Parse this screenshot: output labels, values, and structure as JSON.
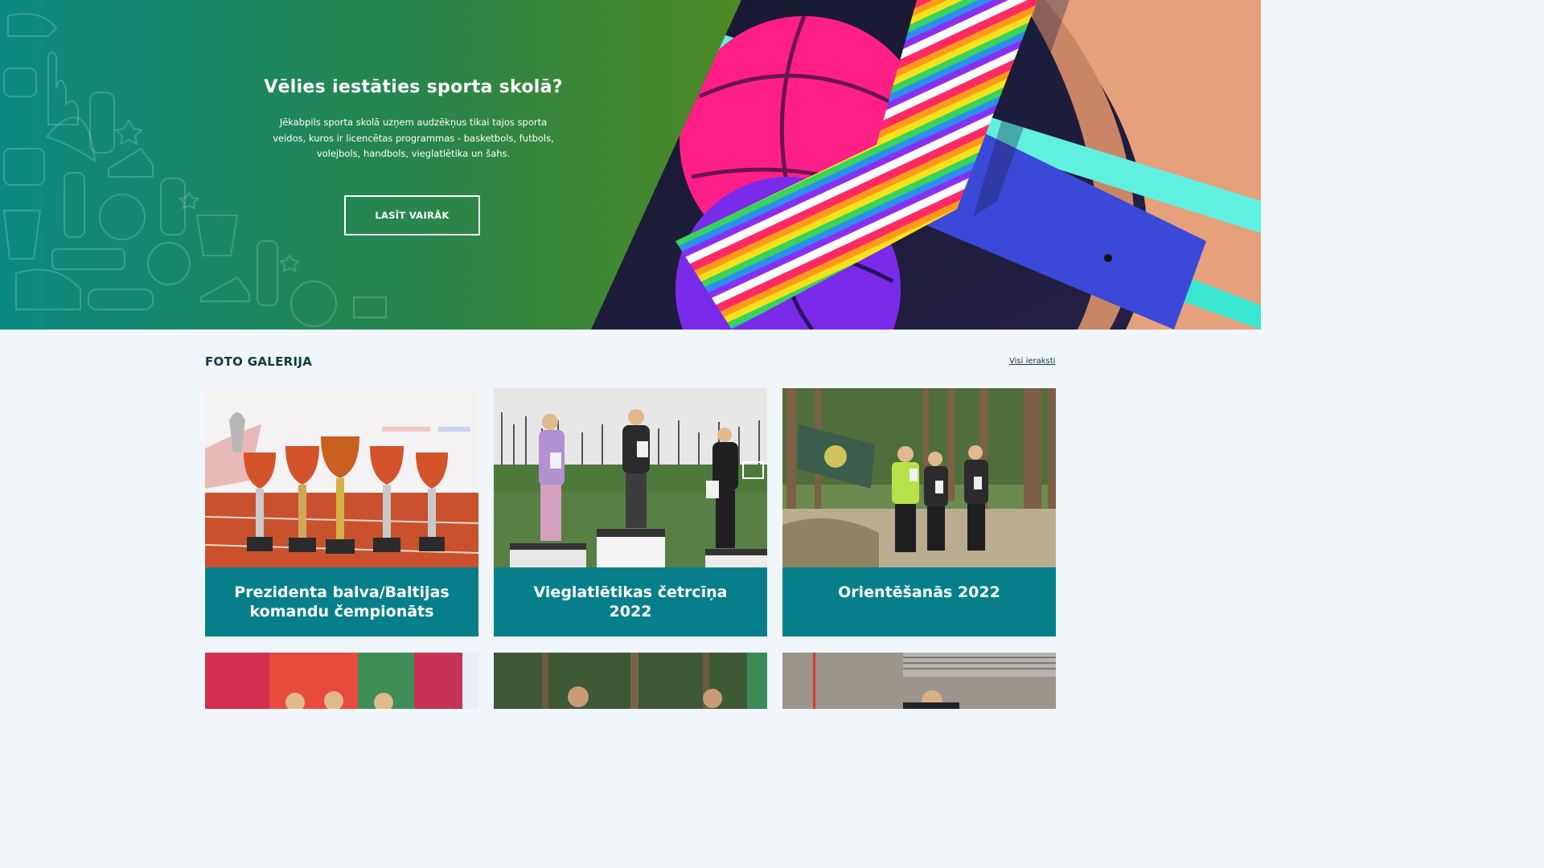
{
  "hero": {
    "title": "Vēlies iestāties sporta skolā?",
    "text": "Jēkabpils sporta skolā uzņem audzēkņus  tikai tajos sporta veidos, kuros ir licencētas programmas - basketbols, futbols, volejbols, handbols, vieglatlētika un šahs.",
    "button_label": "LASĪT VAIRĀK"
  },
  "gallery": {
    "title": "FOTO GALERIJA",
    "all_link": "Visi ieraksti",
    "items": [
      {
        "title": "Prezidenta balva/Baltijas komandu čempionāts"
      },
      {
        "title": "Vieglatlētikas četrcīņa 2022"
      },
      {
        "title": "Orientēšanās 2022"
      }
    ]
  },
  "colors": {
    "caption_bg": "#077f8b",
    "hero_green": "#5f8b12",
    "hero_teal": "#0b8a83",
    "heading": "#0e3a44",
    "page_bg": "#f1f6fa"
  }
}
